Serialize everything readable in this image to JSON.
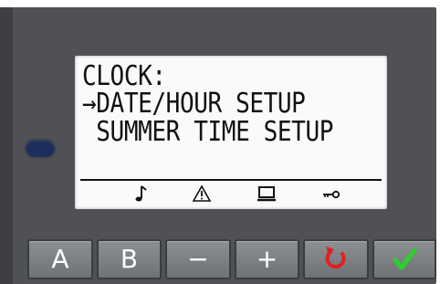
{
  "lcd": {
    "lines": [
      "CLOCK:",
      "→DATE/HOUR SETUP",
      " SUMMER TIME SETUP"
    ],
    "icons": [
      "music-note-icon",
      "warning-icon",
      "monitor-icon",
      "key-icon"
    ]
  },
  "buttons": {
    "a_label": "A",
    "b_label": "B",
    "minus_label": "−",
    "plus_label": "+",
    "back_icon": "undo-arrow-icon",
    "confirm_icon": "checkmark-icon"
  },
  "colors": {
    "panel": "#4f5154",
    "led": "#1d2e5a",
    "lcd_background": "#fafafa",
    "back_icon": "#e02020",
    "confirm_icon": "#2bd12b"
  }
}
